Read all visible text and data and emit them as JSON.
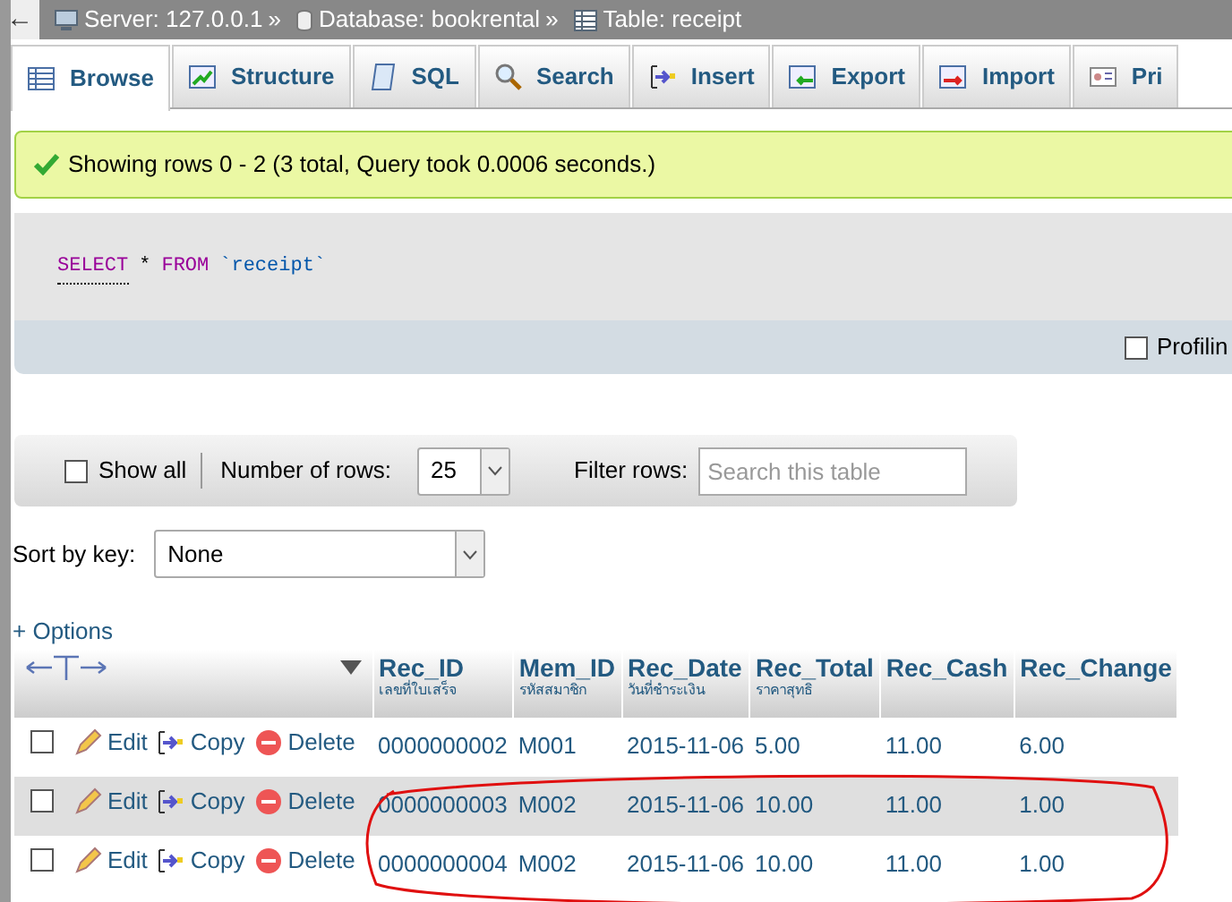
{
  "breadcrumb": [
    {
      "kind": "server",
      "text": "Server: 127.0.0.1"
    },
    {
      "kind": "database",
      "text": "Database: bookrental"
    },
    {
      "kind": "table",
      "text": "Table: receipt"
    }
  ],
  "separator": "»",
  "back": "←",
  "tabs": [
    {
      "kind": "browse",
      "label": "Browse",
      "selected": true
    },
    {
      "kind": "structure",
      "label": "Structure",
      "selected": false
    },
    {
      "kind": "sql",
      "label": "SQL",
      "selected": false
    },
    {
      "kind": "search",
      "label": "Search",
      "selected": false
    },
    {
      "kind": "insert",
      "label": "Insert",
      "selected": false
    },
    {
      "kind": "export",
      "label": "Export",
      "selected": false
    },
    {
      "kind": "import",
      "label": "Import",
      "selected": false
    },
    {
      "kind": "privileges",
      "label": "Pri",
      "selected": false
    }
  ],
  "message": "Showing rows 0 - 2 (3 total, Query took 0.0006 seconds.)",
  "query": [
    {
      "kind": "keyword",
      "text": "SELECT"
    },
    {
      "kind": "operator",
      "text": "*"
    },
    {
      "kind": "keyword",
      "text": "FROM"
    },
    {
      "kind": "identifier",
      "text": "`receipt`"
    }
  ],
  "profiling": {
    "label": "Profilin",
    "checked": false
  },
  "navigation": {
    "show_all": {
      "label": "Show all",
      "checked": false
    },
    "rows_label": "Number of rows:",
    "rows_value": "25",
    "filter_label": "Filter rows:",
    "filter_placeholder": "Search this table"
  },
  "sort": {
    "label": "Sort by key:",
    "value": "None"
  },
  "options": "+ Options",
  "table": {
    "columns": [
      {
        "name": "Rec_ID",
        "comment": "เลขที่ใบเสร็จ"
      },
      {
        "name": "Mem_ID",
        "comment": "รหัสสมาชิก"
      },
      {
        "name": "Rec_Date",
        "comment": "วันที่ชำระเงิน"
      },
      {
        "name": "Rec_Total",
        "comment": "ราคาสุทธิ"
      },
      {
        "name": "Rec_Cash"
      },
      {
        "name": "Rec_Change"
      }
    ],
    "rows": [
      {
        "checked": false,
        "circled": false,
        "actions": [
          "Edit",
          "Copy",
          "Delete"
        ],
        "cells": [
          "0000000002",
          "M001",
          "2015-11-06",
          "5.00",
          "11.00",
          "6.00"
        ]
      },
      {
        "checked": false,
        "circled": true,
        "actions": [
          "Edit",
          "Copy",
          "Delete"
        ],
        "cells": [
          "0000000003",
          "M002",
          "2015-11-06",
          "10.00",
          "11.00",
          "1.00"
        ]
      },
      {
        "checked": false,
        "circled": true,
        "actions": [
          "Edit",
          "Copy",
          "Delete"
        ],
        "cells": [
          "0000000004",
          "M002",
          "2015-11-06",
          "10.00",
          "11.00",
          "1.00"
        ]
      }
    ]
  }
}
